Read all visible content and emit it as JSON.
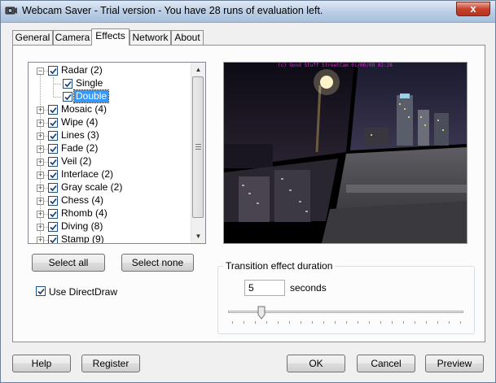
{
  "window": {
    "title": "Webcam Saver - Trial version - You have 28 runs of evaluation left.",
    "close_glyph": "x"
  },
  "tabs": [
    {
      "label": "General",
      "active": false
    },
    {
      "label": "Camera",
      "active": false
    },
    {
      "label": "Effects",
      "active": true
    },
    {
      "label": "Network",
      "active": false
    },
    {
      "label": "About",
      "active": false
    }
  ],
  "effects_tree": {
    "items": [
      {
        "label": "Radar",
        "count": "(2)",
        "expander": "−",
        "checked": true
      },
      {
        "label": "Single",
        "checked": true,
        "child": true
      },
      {
        "label": "Double",
        "checked": true,
        "child": true,
        "selected": true
      },
      {
        "label": "Mosaic",
        "count": "(4)",
        "expander": "+",
        "checked": true
      },
      {
        "label": "Wipe",
        "count": "(4)",
        "expander": "+",
        "checked": true
      },
      {
        "label": "Lines",
        "count": "(3)",
        "expander": "+",
        "checked": true
      },
      {
        "label": "Fade",
        "count": "(2)",
        "expander": "+",
        "checked": true
      },
      {
        "label": "Veil",
        "count": "(2)",
        "expander": "+",
        "checked": true
      },
      {
        "label": "Interlace",
        "count": "(2)",
        "expander": "+",
        "checked": true
      },
      {
        "label": "Gray scale",
        "count": "(2)",
        "expander": "+",
        "checked": true
      },
      {
        "label": "Chess",
        "count": "(4)",
        "expander": "+",
        "checked": true
      },
      {
        "label": "Rhomb",
        "count": "(4)",
        "expander": "+",
        "checked": true
      },
      {
        "label": "Diving",
        "count": "(8)",
        "expander": "+",
        "checked": true
      },
      {
        "label": "Stamp",
        "count": "(9)",
        "expander": "+",
        "checked": true
      }
    ],
    "scroll_up": "▲",
    "scroll_down": "▼"
  },
  "buttons": {
    "select_all": "Select all",
    "select_none": "Select none",
    "help": "Help",
    "register": "Register",
    "ok": "OK",
    "cancel": "Cancel",
    "preview": "Preview"
  },
  "use_directdraw": {
    "label": "Use DirectDraw",
    "checked": true
  },
  "preview_image": {
    "stamp": "(c) Good Stuff StreetCam 01/06/08 02:28"
  },
  "duration": {
    "group_title": "Transition effect duration",
    "value": "5",
    "unit": "seconds",
    "slider_min": 0,
    "slider_max": 60,
    "slider_value": 5
  },
  "colors": {
    "selection": "#3399ff",
    "titlebar": "#b9cde4",
    "close_button": "#c7422d"
  }
}
